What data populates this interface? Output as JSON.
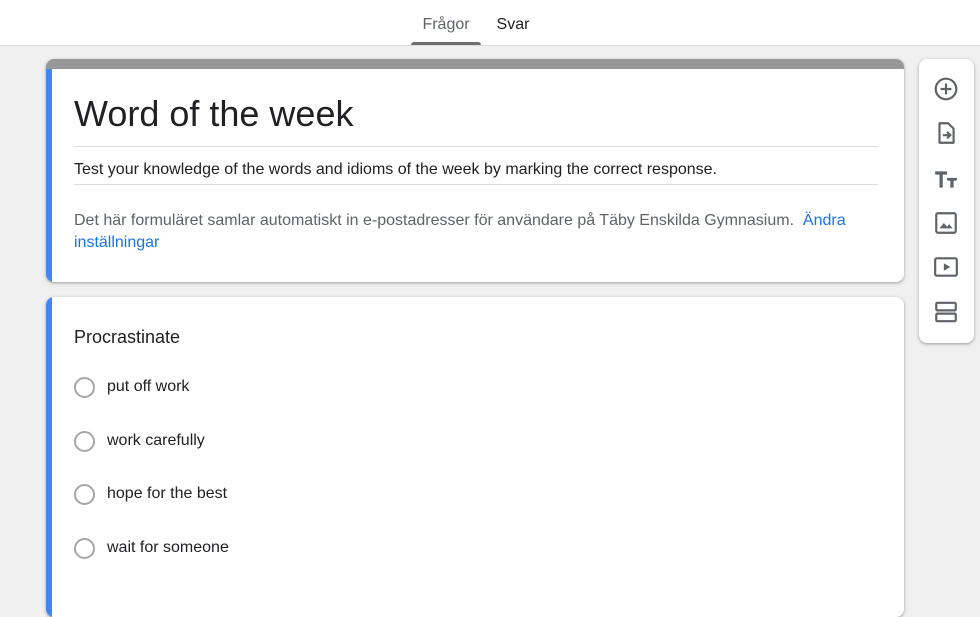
{
  "tabs": [
    {
      "label": "Frågor",
      "active": true
    },
    {
      "label": "Svar",
      "active": false
    }
  ],
  "form": {
    "title": "Word of the week",
    "description": "Test your knowledge of the words and idioms of the week by marking the correct response.",
    "note_text": "Det här formuläret samlar automatiskt in e-postadresser för användare på Täby Enskilda Gymnasium.",
    "note_link": "Ändra inställningar"
  },
  "question": {
    "title": "Procrastinate",
    "options": [
      {
        "label": "put off work"
      },
      {
        "label": "work carefully"
      },
      {
        "label": "hope for the best"
      },
      {
        "label": "wait for someone"
      }
    ]
  },
  "toolbar": {
    "tools": [
      {
        "name": "add-question",
        "icon": "add-circle-icon"
      },
      {
        "name": "import-questions",
        "icon": "import-file-icon"
      },
      {
        "name": "add-title",
        "icon": "text-title-icon"
      },
      {
        "name": "add-image",
        "icon": "image-icon"
      },
      {
        "name": "add-video",
        "icon": "video-icon"
      },
      {
        "name": "add-section",
        "icon": "section-icon"
      }
    ]
  },
  "colors": {
    "accent": "#4285f4",
    "header_band": "#979797",
    "link": "#1a73e8",
    "background": "#f0f0f0"
  }
}
